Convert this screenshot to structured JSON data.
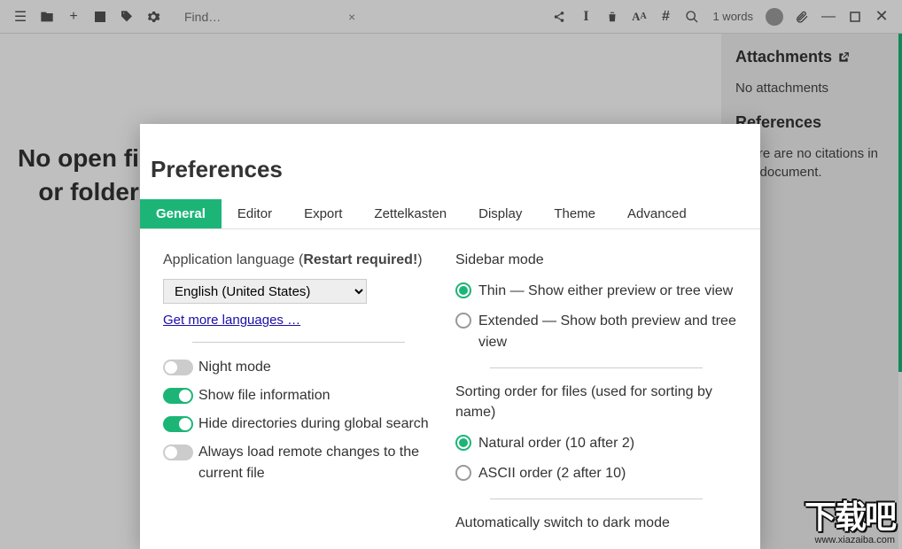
{
  "toolbar": {
    "find_placeholder": "Find…",
    "wordcount": "1 words"
  },
  "sidebar": {
    "sections": {
      "attachments": {
        "title": "Attachments",
        "empty": "No attachments"
      },
      "references": {
        "title": "References",
        "empty": "There are no citations in this document."
      }
    }
  },
  "main_message": {
    "line1": "No open files",
    "line2": "or folders"
  },
  "preferences": {
    "title": "Preferences",
    "tabs": [
      "General",
      "Editor",
      "Export",
      "Zettelkasten",
      "Display",
      "Theme",
      "Advanced"
    ],
    "active_tab": "General",
    "general": {
      "lang_label_prefix": "Application language (",
      "lang_label_bold": "Restart required!",
      "lang_label_suffix": ")",
      "lang_selected": "English (United States)",
      "more_languages": "Get more languages …",
      "toggles": {
        "night_mode": {
          "label": "Night mode",
          "value": false
        },
        "file_info": {
          "label": "Show file information",
          "value": true
        },
        "hide_dirs": {
          "label": "Hide directories during global search",
          "value": true
        },
        "remote_changes": {
          "label": "Always load remote changes to the current file",
          "value": false
        }
      },
      "sidebar_mode": {
        "title": "Sidebar mode",
        "selected": "thin",
        "options": {
          "thin": "Thin — Show either preview or tree view",
          "extended": "Extended — Show both preview and tree view"
        }
      },
      "sort_order": {
        "title": "Sorting order for files (used for sorting by name)",
        "selected": "natural",
        "options": {
          "natural": "Natural order (10 after 2)",
          "ascii": "ASCII order (2 after 10)"
        }
      },
      "dark_mode_auto": "Automatically switch to dark mode"
    }
  },
  "watermark": {
    "big": "下载吧",
    "url": "www.xiazaiba.com"
  }
}
